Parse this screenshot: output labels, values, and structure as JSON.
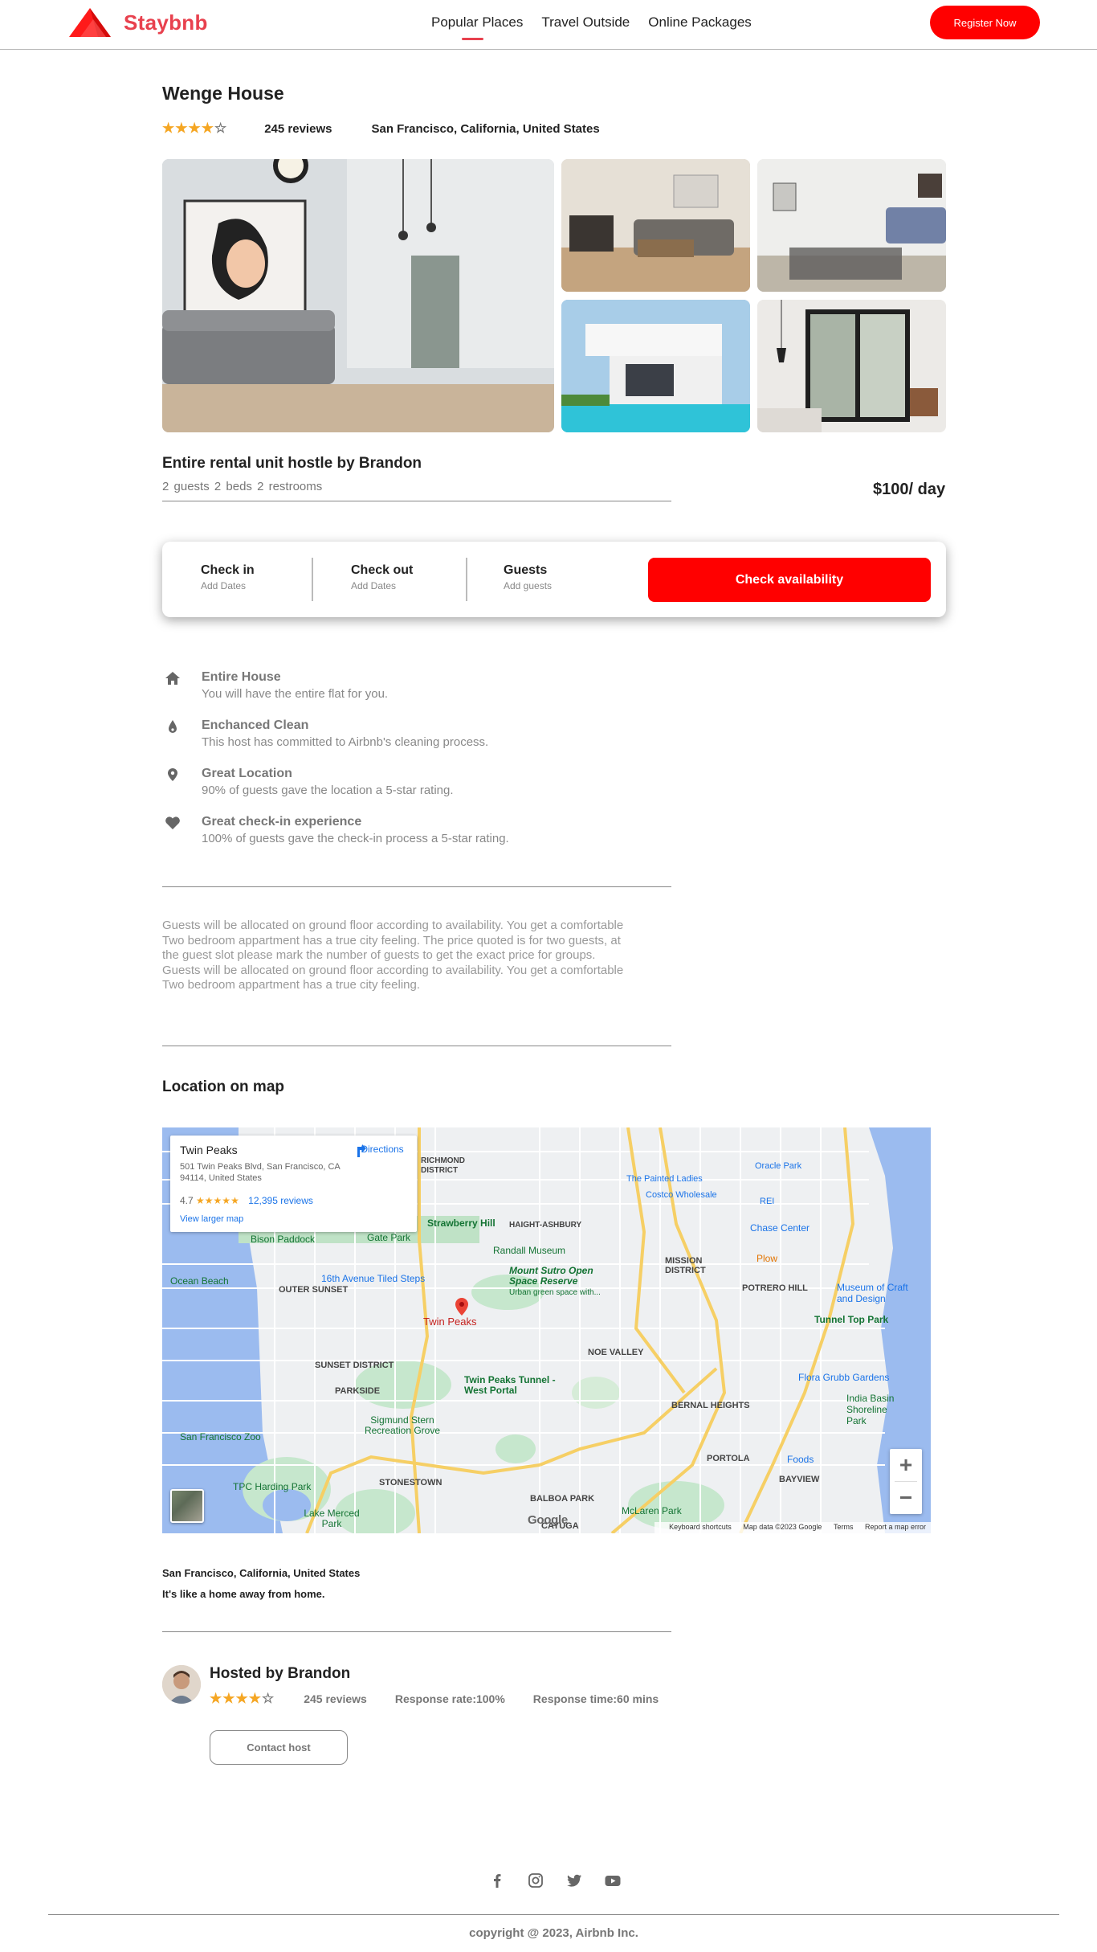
{
  "brand": {
    "name": "Staybnb",
    "accent": "#e8414e",
    "cta_color": "#ff0000"
  },
  "nav": {
    "links": [
      "Popular Places",
      "Travel Outside",
      "Online Packages"
    ],
    "register_label": "Register Now"
  },
  "listing": {
    "title": "Wenge House",
    "rating": 4,
    "rating_max": 5,
    "reviews": "245 reviews",
    "location": "San Francisco, California, United States",
    "rental_title": "Entire rental unit hostle by Brandon",
    "rental_sub": "2 guests  2 beds  2 restrooms",
    "price": "$100/ day"
  },
  "booking": {
    "check_in_label": "Check in",
    "check_in_value": "Add Dates",
    "check_out_label": "Check out",
    "check_out_value": "Add Dates",
    "guests_label": "Guests",
    "guests_value": "Add guests",
    "button_label": "Check availability"
  },
  "features": [
    {
      "icon": "home-icon",
      "title": "Entire House",
      "desc": "You will have the entire flat for you."
    },
    {
      "icon": "drop-icon",
      "title": "Enchanced Clean",
      "desc": "This host has committed to Airbnb's cleaning process."
    },
    {
      "icon": "location-pin-icon",
      "title": "Great Location",
      "desc": "90% of guests gave the location a 5-star rating."
    },
    {
      "icon": "heart-icon",
      "title": "Great check-in experience",
      "desc": "100% of guests gave the check-in process a 5-star rating."
    }
  ],
  "description": "Guests will be allocated on ground floor according to availability. You get a comfortable Two bedroom appartment has a true city feeling. The price quoted is for two guests, at the guest slot please mark the number of guests to get the exact price for groups. Guests will be allocated on ground floor according to availability. You get a comfortable Two bedroom appartment has a true city feeling.",
  "map": {
    "section_title": "Location on map",
    "card": {
      "name": "Twin Peaks",
      "address": "501 Twin Peaks Blvd, San Francisco, CA 94114, United States",
      "rating": "4.7",
      "stars": "★★★★★",
      "reviews": "12,395 reviews",
      "larger_link": "View larger map",
      "directions": "Directions"
    },
    "labels": {
      "twin_peaks": "Twin Peaks",
      "richmond": "RICHMOND DISTRICT",
      "haight": "HAIGHT-ASHBURY",
      "painted_ladies": "The Painted Ladies",
      "costco": "Costco Wholesale",
      "rei": "REI",
      "oracle": "Oracle Park",
      "strawberry": "Strawberry Hill",
      "bison": "Bison Paddock",
      "golden_gate": "Golden Gate Park",
      "randall": "Randall Museum",
      "chase": "Chase Center",
      "plow": "Plow",
      "ocean_beach": "Ocean Beach",
      "outer_sunset": "OUTER SUNSET",
      "tiled_steps": "16th Avenue Tiled Steps",
      "sutro": "Mount Sutro Open Space Reserve",
      "sutro_sub": "Urban green space with...",
      "mission": "MISSION DISTRICT",
      "potrero": "POTRERO HILL",
      "museum_craft": "Museum of Craft and Design",
      "tunnel_top": "Tunnel Top Park",
      "noe": "NOE VALLEY",
      "sunset": "SUNSET DISTRICT",
      "parkside": "PARKSIDE",
      "tunnel": "Twin Peaks Tunnel - West Portal",
      "flora": "Flora Grubb Gardens",
      "india_basin": "India Basin Shoreline Park",
      "bernal": "BERNAL HEIGHTS",
      "sigmund": "Sigmund Stern Recreation Grove",
      "sf_zoo": "San Francisco Zoo",
      "portola": "PORTOLA",
      "foods": "Foods",
      "bayview": "BAYVIEW",
      "tpc": "TPC Harding Park",
      "stonestown": "STONESTOWN",
      "balboa": "BALBOA PARK",
      "mclaren": "McLaren Park",
      "lake_merced": "Lake Merced Park",
      "cayuga": "CAYUGA",
      "google": "Google"
    },
    "footer": {
      "shortcuts": "Keyboard shortcuts",
      "map_data": "Map data ©2023 Google",
      "terms": "Terms",
      "report": "Report a map error"
    },
    "caption": "San Francisco, California, United States",
    "tagline": "It's like a home away from home."
  },
  "host": {
    "title": "Hosted by Brandon",
    "rating": 4,
    "reviews": "245 reviews",
    "response_rate": "Response rate:100%",
    "response_time": "Response time:60 mins",
    "contact_label": "Contact host"
  },
  "footer": {
    "socials": [
      "facebook-icon",
      "instagram-icon",
      "twitter-icon",
      "youtube-icon"
    ],
    "copyright": "copyright @ 2023, Airbnb Inc."
  }
}
